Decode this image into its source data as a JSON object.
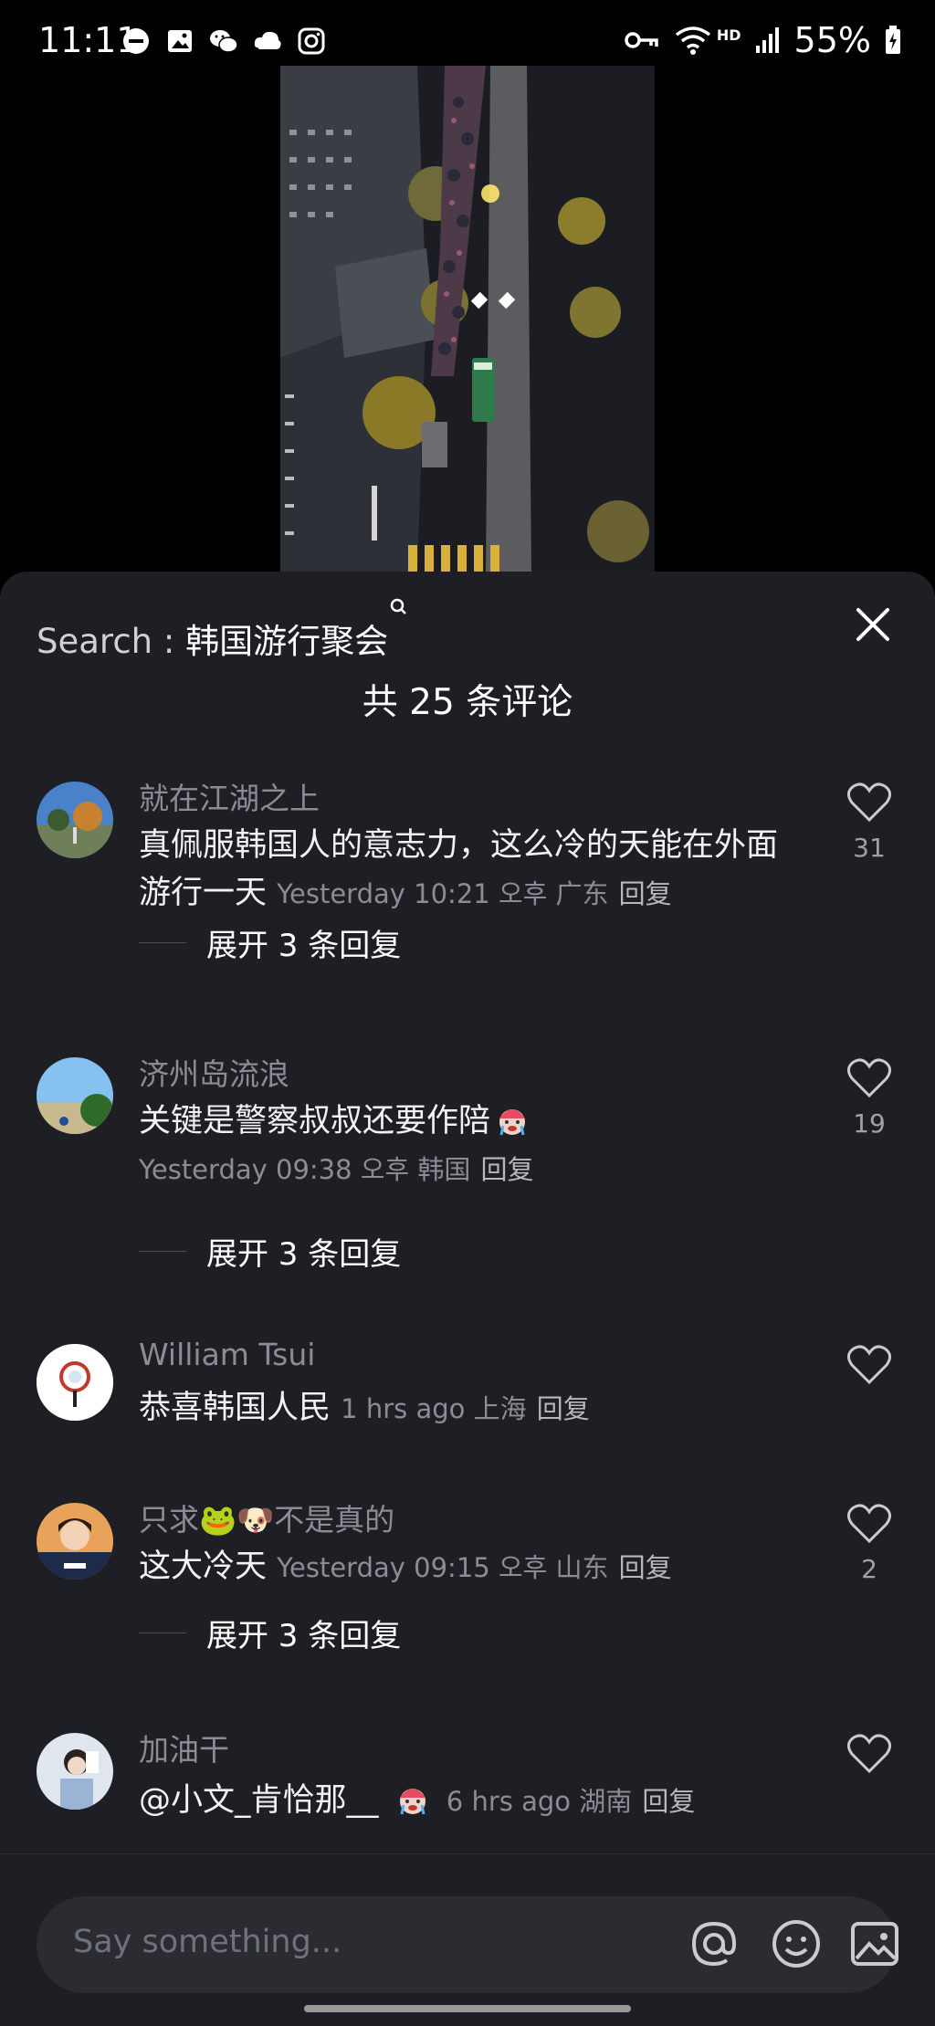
{
  "status_bar": {
    "time": "11:11",
    "battery": "55%",
    "network": "HD",
    "left_icons": [
      "dnd-icon",
      "gallery-icon",
      "wechat-icon",
      "cloud-icon",
      "instagram-icon"
    ],
    "right_icons": [
      "vpn-key-icon",
      "wifi-icon",
      "signal-icon",
      "battery-icon"
    ]
  },
  "video": {
    "description_icon": "video-thumbnail"
  },
  "sheet": {
    "search_label": "Search : ",
    "search_keyword": "韩国游行聚会",
    "search_sup": "Q",
    "comment_count": "共 25 条评论"
  },
  "comments": [
    {
      "username": "就在江湖之上",
      "text": "真佩服韩国人的意志力，这么冷的天能在外面游行一天",
      "time": "Yesterday 10:21 오후 广东",
      "reply": "回复",
      "likes": "31",
      "expand": "展开 3 条回复"
    },
    {
      "username": "济州岛流浪",
      "text": "关键是警察叔叔还要作陪",
      "time": "Yesterday 09:38 오후 韩国",
      "reply": "回复",
      "likes": "19",
      "expand": "展开 3 条回复"
    },
    {
      "username": "William Tsui",
      "text": "恭喜韩国人民",
      "time": "1 hrs ago 上海",
      "reply": "回复",
      "likes": ""
    },
    {
      "username": "只求🐸🐶不是真的",
      "text": "这大冷天",
      "time": "Yesterday 09:15 오후 山东",
      "reply": "回复",
      "likes": "2",
      "expand": "展开 3 条回复"
    },
    {
      "username": "加油干",
      "text": "@小文_肯恰那__ ",
      "time": "6 hrs ago 湖南",
      "reply": "回复",
      "likes": ""
    }
  ],
  "input": {
    "placeholder": "Say something...",
    "icons": [
      "at-icon",
      "emoji-icon",
      "image-icon"
    ]
  },
  "colors": {
    "sheet_bg": "#1e1f24",
    "muted_text": "#8a8d94",
    "accent_text": "#ffffff"
  }
}
